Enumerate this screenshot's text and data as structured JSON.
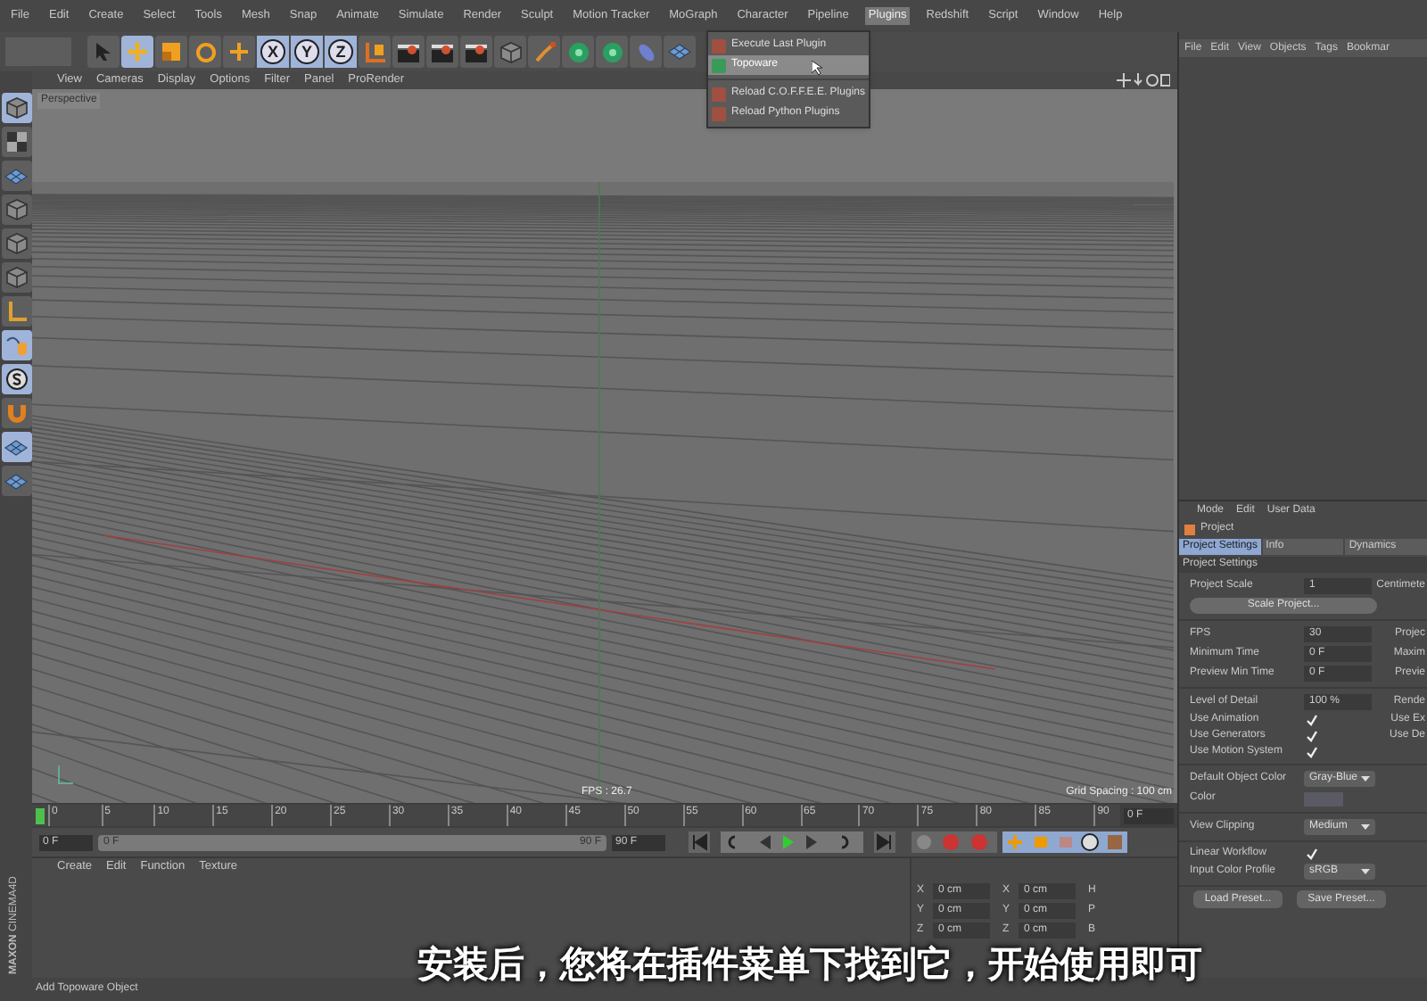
{
  "menu_bar": [
    {
      "label": "File",
      "selected": false
    },
    {
      "label": "Edit",
      "selected": false
    },
    {
      "label": "Create",
      "selected": false
    },
    {
      "label": "Select",
      "selected": false
    },
    {
      "label": "Tools",
      "selected": false
    },
    {
      "label": "Mesh",
      "selected": false
    },
    {
      "label": "Snap",
      "selected": false
    },
    {
      "label": "Animate",
      "selected": false
    },
    {
      "label": "Simulate",
      "selected": false
    },
    {
      "label": "Render",
      "selected": false
    },
    {
      "label": "Sculpt",
      "selected": false
    },
    {
      "label": "Motion Tracker",
      "selected": false
    },
    {
      "label": "MoGraph",
      "selected": false
    },
    {
      "label": "Character",
      "selected": false
    },
    {
      "label": "Pipeline",
      "selected": false
    },
    {
      "label": "Plugins",
      "selected": true
    },
    {
      "label": "Redshift",
      "selected": false
    },
    {
      "label": "Script",
      "selected": false
    },
    {
      "label": "Window",
      "selected": false
    },
    {
      "label": "Help",
      "selected": false
    }
  ],
  "toolbar": [
    {
      "kind": "select",
      "selected": false
    },
    {
      "kind": "move",
      "selected": true
    },
    {
      "kind": "scale",
      "selected": false
    },
    {
      "kind": "rotate",
      "selected": false
    },
    {
      "kind": "add",
      "selected": false
    },
    {
      "kind": "axis",
      "label": "X",
      "selected": true
    },
    {
      "kind": "axis",
      "label": "Y",
      "selected": true
    },
    {
      "kind": "axis",
      "label": "Z",
      "selected": true
    },
    {
      "kind": "coords",
      "selected": false
    },
    {
      "kind": "clapper",
      "selected": false
    },
    {
      "kind": "clapper",
      "selected": false
    },
    {
      "kind": "clapper",
      "selected": false
    },
    {
      "kind": "cube",
      "selected": false
    },
    {
      "kind": "pen",
      "selected": false
    },
    {
      "kind": "subdivision",
      "selected": false
    },
    {
      "kind": "subdivision",
      "selected": false
    },
    {
      "kind": "deformer",
      "selected": false
    },
    {
      "kind": "floor",
      "selected": false
    }
  ],
  "plugins_menu": [
    {
      "kind": "item",
      "label": "Execute Last Plugin",
      "selected": false
    },
    {
      "kind": "item",
      "label": "Topoware",
      "selected": true
    },
    {
      "kind": "separator"
    },
    {
      "kind": "item",
      "label": "Reload C.O.F.F.E.E. Plugins",
      "selected": false
    },
    {
      "kind": "item",
      "label": "Reload Python Plugins",
      "selected": false
    }
  ],
  "left_tools": [
    {
      "kind": "cube",
      "selected": true
    },
    {
      "kind": "checker",
      "selected": false
    },
    {
      "kind": "floor",
      "selected": false
    },
    {
      "kind": "cube",
      "selected": false
    },
    {
      "kind": "cube",
      "selected": false
    },
    {
      "kind": "cube",
      "selected": false
    },
    {
      "kind": "axis",
      "selected": false
    },
    {
      "kind": "spline",
      "selected": true
    },
    {
      "kind": "snap",
      "selected": true
    },
    {
      "kind": "magnet",
      "selected": false
    },
    {
      "kind": "floor",
      "selected": true
    },
    {
      "kind": "floor",
      "selected": false
    }
  ],
  "viewport": {
    "menu": [
      "View",
      "Cameras",
      "Display",
      "Options",
      "Filter",
      "Panel",
      "ProRender"
    ],
    "camera": "Perspective",
    "fps": "FPS : 26.7",
    "grid_spacing": "Grid Spacing : 100 cm"
  },
  "object_manager": {
    "menu": [
      "File",
      "Edit",
      "View",
      "Objects",
      "Tags",
      "Bookmar"
    ]
  },
  "attribute_manager": {
    "menu": [
      "Mode",
      "Edit",
      "User Data"
    ],
    "title": "Project",
    "tabs": [
      {
        "label": "Project Settings",
        "selected": true
      },
      {
        "label": "Info",
        "selected": false
      },
      {
        "label": "Dynamics",
        "selected": false
      }
    ],
    "section": "Project Settings",
    "sections": [
      [
        {
          "kind": "number",
          "label": "Project Scale",
          "value": "1",
          "side": "Centimete"
        },
        {
          "kind": "button",
          "label": "Scale Project..."
        }
      ],
      [
        {
          "kind": "number",
          "label": "FPS",
          "value": "30",
          "side": "Projec"
        },
        {
          "kind": "number",
          "label": "Minimum Time",
          "value": "0 F",
          "side": "Maxim"
        },
        {
          "kind": "number",
          "label": "Preview Min Time",
          "value": "0 F",
          "side": "Previe"
        }
      ],
      [
        {
          "kind": "number",
          "label": "Level of Detail",
          "value": "100 %",
          "side": "Rende"
        },
        {
          "kind": "check",
          "label": "Use Animation",
          "checked": true,
          "side": "Use Ex"
        },
        {
          "kind": "check",
          "label": "Use Generators",
          "checked": true,
          "side": "Use De"
        },
        {
          "kind": "check",
          "label": "Use Motion System",
          "checked": true
        }
      ],
      [
        {
          "kind": "dropdown",
          "label": "Default Object Color",
          "value": "Gray-Blue"
        },
        {
          "kind": "swatch",
          "label": "Color"
        }
      ],
      [
        {
          "kind": "dropdown",
          "label": "View Clipping",
          "value": "Medium"
        }
      ],
      [
        {
          "kind": "check",
          "label": "Linear Workflow",
          "checked": true
        },
        {
          "kind": "dropdown",
          "label": "Input Color Profile",
          "value": "sRGB"
        }
      ]
    ],
    "buttons": [
      "Load Preset...",
      "Save Preset..."
    ]
  },
  "timeline": {
    "ticks": [
      "0",
      "5",
      "10",
      "15",
      "20",
      "25",
      "30",
      "35",
      "40",
      "45",
      "50",
      "55",
      "60",
      "65",
      "70",
      "75",
      "80",
      "85",
      "90"
    ],
    "current": "0 F",
    "start": "0 F",
    "slider_start": "0 F",
    "slider_end": "90 F",
    "level": 1,
    "end": "90 F"
  },
  "material_manager": {
    "menu": [
      "Create",
      "Edit",
      "Function",
      "Texture"
    ]
  },
  "coordinates": [
    {
      "axis": "X",
      "position": "0 cm",
      "size_axis": "X",
      "size": "0 cm",
      "rotation_axis": "H"
    },
    {
      "axis": "Y",
      "position": "0 cm",
      "size_axis": "Y",
      "size": "0 cm",
      "rotation_axis": "P"
    },
    {
      "axis": "Z",
      "position": "0 cm",
      "size_axis": "Z",
      "size": "0 cm",
      "rotation_axis": "B"
    }
  ],
  "logo": {
    "brand": "MAXON",
    "product": "CINEMA4D"
  },
  "status_bar": "Add Topoware Object",
  "subtitle": "安装后，您将在插件菜单下找到它，开始使用即可"
}
